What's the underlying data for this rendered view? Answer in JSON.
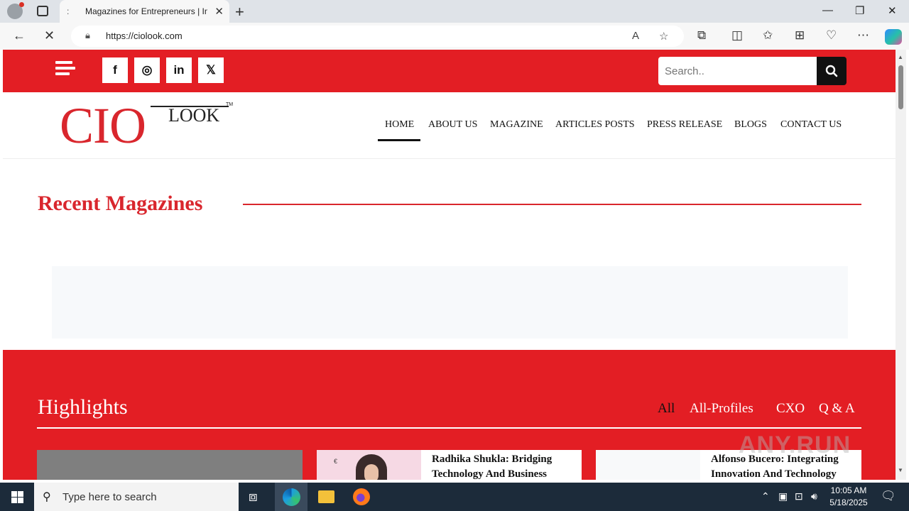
{
  "browser": {
    "tab_title": "Magazines for Entrepreneurs | Int",
    "tab_favicon": ":",
    "url": "https://ciolook.com",
    "new_tab": "+",
    "close_tab": "✕"
  },
  "window_controls": {
    "minimize": "—",
    "restore": "❐",
    "close": "✕"
  },
  "site": {
    "search_placeholder": "Search..",
    "social": {
      "facebook": "f",
      "instagram": "◎",
      "linkedin": "in",
      "x": "𝕏"
    },
    "logo": {
      "cio": "CIO",
      "look": "LOOK",
      "tm": "TM"
    },
    "menu": [
      "HOME",
      "ABOUT US",
      "MAGAZINE",
      "ARTICLES POSTS",
      "PRESS RELEASE",
      "BLOGS",
      "CONTACT US"
    ],
    "recent_title": "Recent Magazines",
    "highlights": {
      "title": "Highlights",
      "filters": [
        "All",
        "All-Profiles",
        "CXO",
        "Q & A"
      ],
      "cards": [
        {
          "title": "Radhika Shukla: Bridging Technology And Business"
        },
        {
          "title": "Alfonso Bucero: Integrating Innovation And Technology"
        }
      ]
    }
  },
  "watermark": "ANY.RUN",
  "taskbar": {
    "search_placeholder": "Type here to search",
    "time": "10:05 AM",
    "date": "5/18/2025"
  }
}
